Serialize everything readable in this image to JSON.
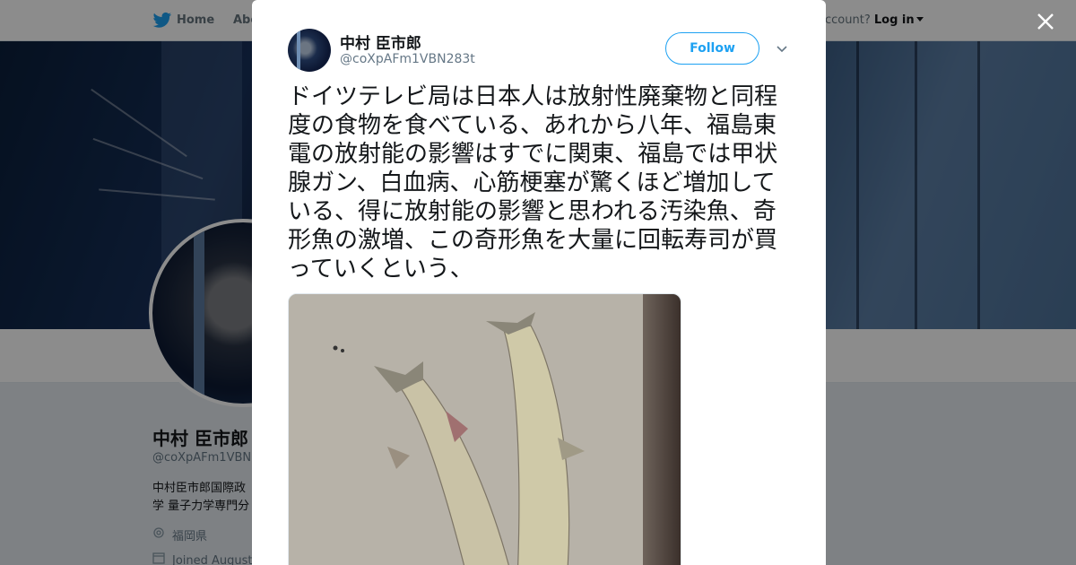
{
  "nav": {
    "home_label": "Home",
    "about_label": "Abo",
    "account_prompt": "ccount?",
    "login_label": "Log in"
  },
  "profile": {
    "name": "中村 臣市郎",
    "handle": "@coXpAFm1VBN",
    "bio_line1": "中村臣市郎国際政",
    "bio_line2": "学 量子力学専門分",
    "location": "福岡県",
    "joined": "Joined August"
  },
  "tweet": {
    "author_name": "中村 臣市郎",
    "author_handle": "@coXpAFm1VBN283t",
    "follow_label": "Follow",
    "text": "ドイツテレビ局は日本人は放射性廃棄物と同程度の食物を食べている、あれから八年、福島東電の放射能の影響はすでに関東、福島では甲状腺ガン、白血病、心筋梗塞が驚くほど増加している、得に放射能の影響と思われる汚染魚、奇形魚の激増、この奇形魚を大量に回転寿司が買っていくという、"
  },
  "icons": {
    "brand": "twitter-bird-icon",
    "close": "close-icon",
    "menu": "chevron-down-icon",
    "location": "location-pin-icon",
    "calendar": "calendar-icon"
  },
  "colors": {
    "accent": "#1da1f2",
    "text": "#14171a",
    "secondary": "#657786"
  }
}
